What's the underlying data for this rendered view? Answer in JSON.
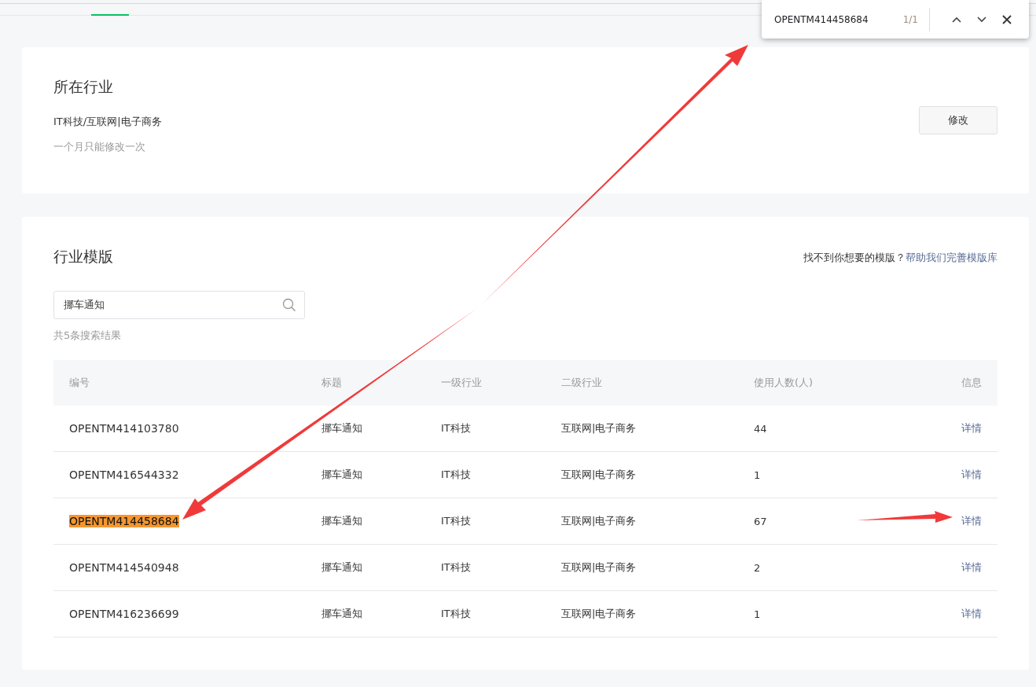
{
  "find_bar": {
    "query": "OPENTM414458684",
    "count": "1/1"
  },
  "industry": {
    "title": "所在行业",
    "value": "IT科技/互联网|电子商务",
    "note": "一个月只能修改一次",
    "button": "修改"
  },
  "templates": {
    "title": "行业模版",
    "help_text": "找不到你想要的模版？",
    "help_link": "帮助我们完善模版库",
    "search": {
      "value": "挪车通知"
    },
    "result_count": "共5条搜索结果",
    "table": {
      "columns": [
        "编号",
        "标题",
        "一级行业",
        "二级行业",
        "使用人数(人)",
        "信息"
      ],
      "rows": [
        {
          "id": "OPENTM414103780",
          "title": "挪车通知",
          "industry_1": "IT科技",
          "industry_2": "互联网|电子商务",
          "users": "44",
          "action": "详情",
          "highlighted": false
        },
        {
          "id": "OPENTM416544332",
          "title": "挪车通知",
          "industry_1": "IT科技",
          "industry_2": "互联网|电子商务",
          "users": "1",
          "action": "详情",
          "highlighted": false
        },
        {
          "id": "OPENTM414458684",
          "title": "挪车通知",
          "industry_1": "IT科技",
          "industry_2": "互联网|电子商务",
          "users": "67",
          "action": "详情",
          "highlighted": true
        },
        {
          "id": "OPENTM414540948",
          "title": "挪车通知",
          "industry_1": "IT科技",
          "industry_2": "互联网|电子商务",
          "users": "2",
          "action": "详情",
          "highlighted": false
        },
        {
          "id": "OPENTM416236699",
          "title": "挪车通知",
          "industry_1": "IT科技",
          "industry_2": "互联网|电子商务",
          "users": "1",
          "action": "详情",
          "highlighted": false
        }
      ]
    }
  }
}
